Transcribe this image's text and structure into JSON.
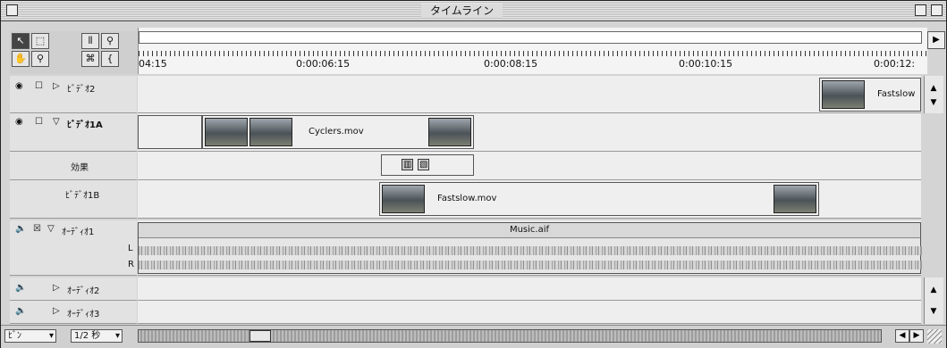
{
  "window": {
    "title": "タイムライン"
  },
  "toolbox": {
    "tools": [
      {
        "name": "selection-tool",
        "glyph": "↖"
      },
      {
        "name": "range-select-tool",
        "glyph": "⬚"
      },
      {
        "name": "razor-tool",
        "glyph": "⦀"
      },
      {
        "name": "link-tool",
        "glyph": "⚲"
      },
      {
        "name": "hand-tool",
        "glyph": "✋"
      },
      {
        "name": "zoom-tool",
        "glyph": "🔍"
      },
      {
        "name": "cross-tool",
        "glyph": "⌘"
      },
      {
        "name": "in-out-tool",
        "glyph": "{"
      }
    ]
  },
  "ruler": {
    "timecodes": [
      "04:15",
      "0:00:06:15",
      "0:00:08:15",
      "0:00:10:15",
      "0:00:12:"
    ]
  },
  "tracks": {
    "video2": {
      "label": "ﾋﾞﾃﾞｵ2"
    },
    "video1a": {
      "label": "ﾋﾞﾃﾞｵ1A"
    },
    "transition": {
      "label": "効果"
    },
    "video1b": {
      "label": "ﾋﾞﾃﾞｵ1B"
    },
    "audio1": {
      "label": "ｵｰﾃﾞｨｵ1",
      "channel_l": "L",
      "channel_r": "R"
    },
    "audio2": {
      "label": "ｵｰﾃﾞｨｵ2"
    },
    "audio3": {
      "label": "ｵｰﾃﾞｨｵ3"
    }
  },
  "clips": {
    "cyclers": "Cyclers.mov",
    "fastslow_v2": "Fastslow",
    "fastslow_v1b": "Fastslow.mov",
    "music": "Music.aif"
  },
  "bottom": {
    "bin_select": "ﾋﾞﾝ",
    "zoom_select": "1/2 秒"
  },
  "colors": {
    "thumb_dark": "#4c5358",
    "track_bg": "#eeeeee",
    "header_bg": "#e2e2e2"
  }
}
